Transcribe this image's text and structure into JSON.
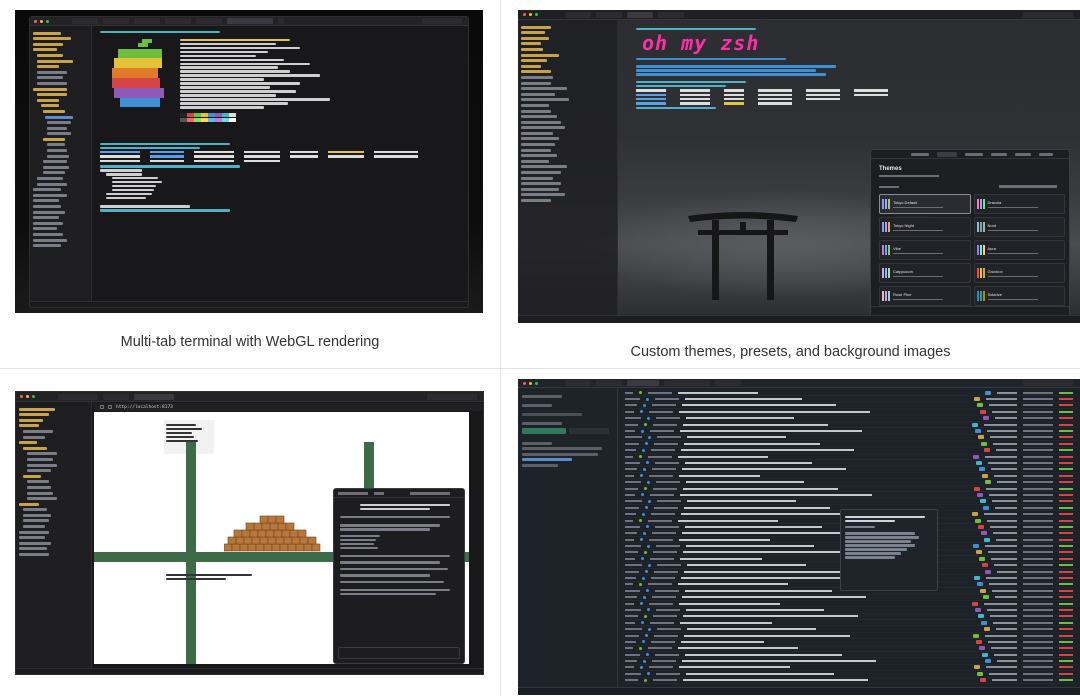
{
  "captions": {
    "top_left": "Multi-tab terminal with WebGL rendering",
    "top_right": "Custom themes, presets, and background images",
    "bottom_left": "",
    "bottom_right": ""
  },
  "theme_panel": {
    "title": "Themes",
    "presets": [
      "Tokyo Default",
      "Dracula",
      "Tokyo Night",
      "Nord",
      "Vibe",
      "Aura",
      "Catppuccin",
      "Gruvbox",
      "Rose Pine",
      "Solarize"
    ]
  },
  "logo_text": "oh my zsh",
  "browser_url": "http://localhost:8173",
  "colors": {
    "window_bg": "#1b1b1d",
    "apple_green": "#6fbf3c",
    "apple_yellow": "#e2c33a",
    "apple_orange": "#e07b2c",
    "apple_red": "#d64545",
    "apple_purple": "#8e59b8",
    "apple_blue": "#3f8fd6",
    "ohmyzsh_pink": "#ff2fa8"
  }
}
